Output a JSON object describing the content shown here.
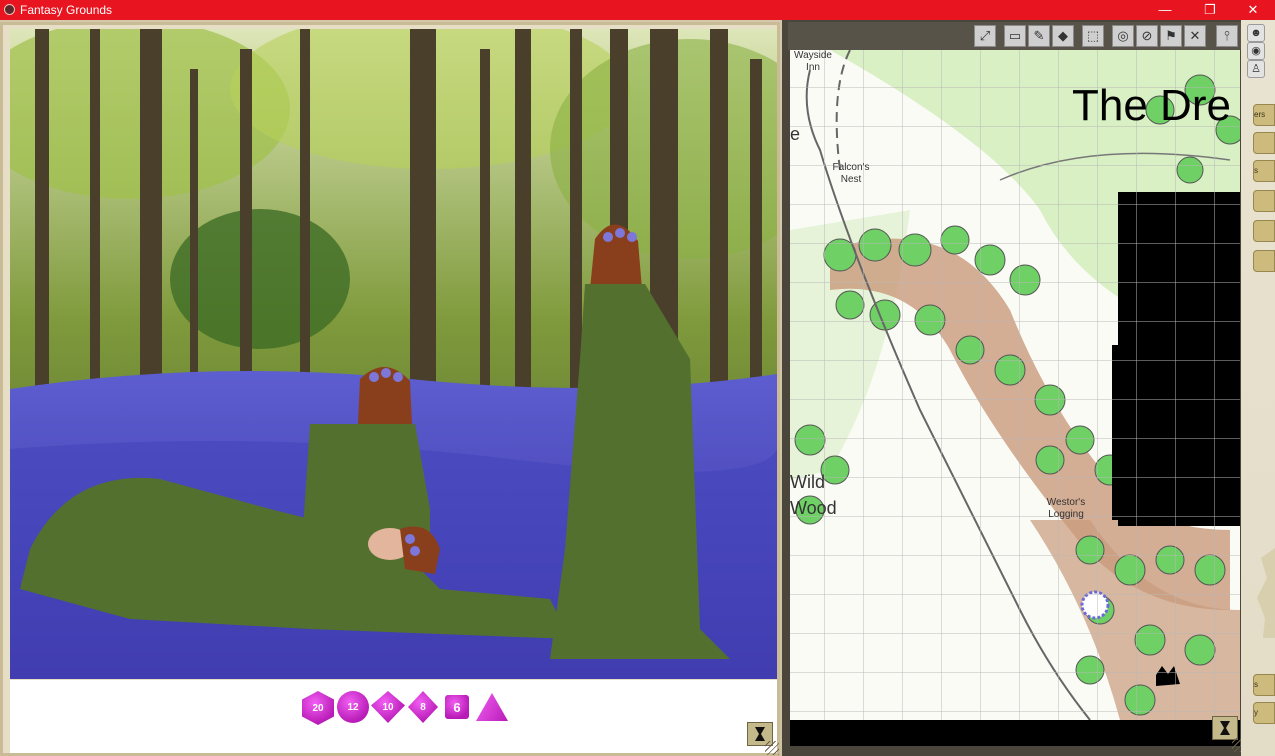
{
  "window": {
    "title": "Fantasy Grounds",
    "controls": {
      "minimize": "—",
      "restore": "❐",
      "close": "✕"
    }
  },
  "image_panel": {
    "dice": [
      {
        "name": "d20",
        "label": "20"
      },
      {
        "name": "d12",
        "label": "12"
      },
      {
        "name": "d10",
        "label": "10"
      },
      {
        "name": "d8",
        "label": "8"
      },
      {
        "name": "d6",
        "label": "6"
      },
      {
        "name": "d4",
        "label": ""
      }
    ],
    "dice_color": "#c52bc8"
  },
  "map_panel": {
    "title": "The Dre",
    "labels": {
      "wayside": "Wayside\nInn",
      "falcons": "Falcon's\nNest",
      "wild_wood_1": "Wild",
      "wild_wood_2": "Wood",
      "westors": "Westor's\nLogging",
      "partial_letter": "e"
    },
    "toolbar": [
      "fullscreen-icon",
      "mask-icon",
      "brush-icon",
      "eraser-icon",
      "select-icon",
      "target-icon",
      "no-target-icon",
      "flag-icon",
      "clear-icon",
      "pin-icon"
    ],
    "colors": {
      "grid": "#b8b8b8",
      "foliage": "#5fd35a",
      "trunk": "#b5815f"
    }
  },
  "sidebar": {
    "icons": [
      "party-icon",
      "globe-icon",
      "character-icon"
    ],
    "buttons": [
      "ers",
      "",
      "s",
      "",
      "",
      "",
      "s",
      "y"
    ]
  }
}
